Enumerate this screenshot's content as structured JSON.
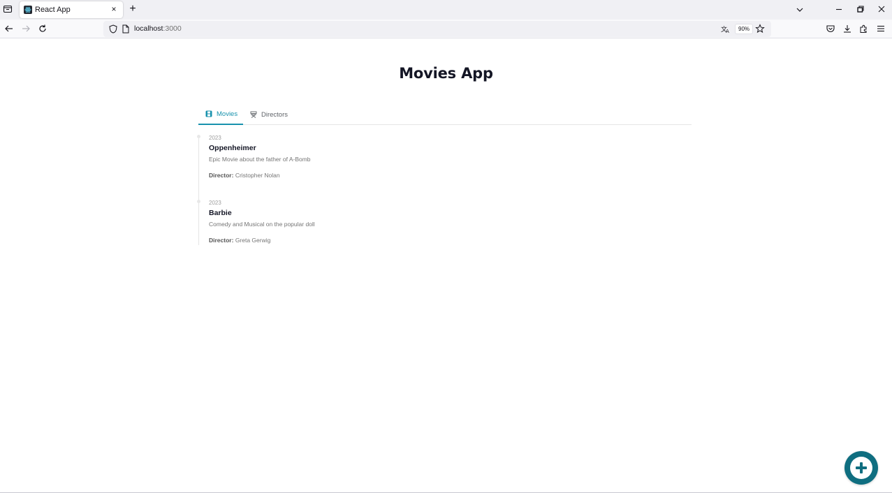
{
  "browser": {
    "tab_title": "React App",
    "tab_close": "×",
    "new_tab": "+",
    "url_host": "localhost",
    "url_port": ":3000",
    "zoom": "90%"
  },
  "app": {
    "title": "Movies App",
    "tabs": [
      {
        "label": "Movies",
        "active": true,
        "icon": "film-icon"
      },
      {
        "label": "Directors",
        "active": false,
        "icon": "director-chair-icon"
      }
    ],
    "movies": [
      {
        "year": "2023",
        "title": "Oppenheimer",
        "description": "Epic Movie about the father of A-Bomb",
        "director_label": "Director:",
        "director": "Cristopher Nolan"
      },
      {
        "year": "2023",
        "title": "Barbie",
        "description": "Comedy and Musical on the popular doll",
        "director_label": "Director:",
        "director": "Greta Gerwig"
      }
    ],
    "accent_color": "#1892ad",
    "fab_color": "#0f6e80",
    "fab_icon": "plus-circle-icon"
  }
}
